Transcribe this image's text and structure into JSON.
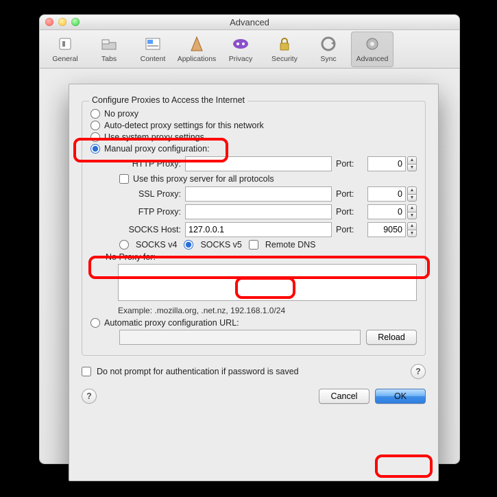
{
  "window": {
    "title": "Advanced"
  },
  "toolbar": {
    "items": [
      {
        "label": "General"
      },
      {
        "label": "Tabs"
      },
      {
        "label": "Content"
      },
      {
        "label": "Applications"
      },
      {
        "label": "Privacy"
      },
      {
        "label": "Security"
      },
      {
        "label": "Sync"
      },
      {
        "label": "Advanced"
      }
    ]
  },
  "dialog": {
    "group_title": "Configure Proxies to Access the Internet",
    "radios": {
      "no_proxy": "No proxy",
      "auto_detect": "Auto-detect proxy settings for this network",
      "system": "Use system proxy settings",
      "manual": "Manual proxy configuration:"
    },
    "fields": {
      "http_label": "HTTP Proxy:",
      "http_value": "",
      "http_port": "0",
      "use_all_label": "Use this proxy server for all protocols",
      "ssl_label": "SSL Proxy:",
      "ssl_value": "",
      "ssl_port": "0",
      "ftp_label": "FTP Proxy:",
      "ftp_value": "",
      "ftp_port": "0",
      "socks_label": "SOCKS Host:",
      "socks_value": "127.0.0.1",
      "socks_port": "9050",
      "port_label": "Port:",
      "socks_v4": "SOCKS v4",
      "socks_v5": "SOCKS v5",
      "remote_dns": "Remote DNS",
      "no_proxy_for_label": "No Proxy for:",
      "no_proxy_for_value": "",
      "example": "Example: .mozilla.org, .net.nz, 192.168.1.0/24",
      "auto_url_label": "Automatic proxy configuration URL:",
      "auto_url_value": "",
      "reload": "Reload"
    },
    "do_not_prompt": "Do not prompt for authentication if password is saved",
    "cancel": "Cancel",
    "ok": "OK",
    "help": "?"
  }
}
